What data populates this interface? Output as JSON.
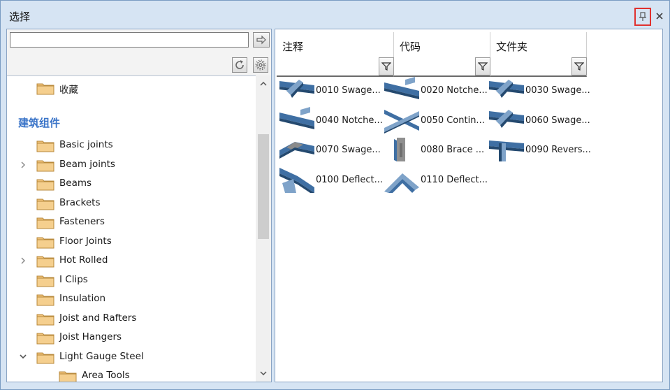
{
  "window": {
    "title": "选择"
  },
  "titlebar": {
    "pin_icon": "pin-icon",
    "close_icon": "close-icon"
  },
  "search": {
    "value": "",
    "placeholder": ""
  },
  "tree": {
    "favorites": "收藏",
    "group_header": "建筑组件",
    "items": [
      {
        "label": "Basic joints",
        "expander": ""
      },
      {
        "label": "Beam joints",
        "expander": ">"
      },
      {
        "label": "Beams",
        "expander": ""
      },
      {
        "label": "Brackets",
        "expander": ""
      },
      {
        "label": "Fasteners",
        "expander": ""
      },
      {
        "label": "Floor Joints",
        "expander": ""
      },
      {
        "label": "Hot Rolled",
        "expander": ">"
      },
      {
        "label": "I Clips",
        "expander": ""
      },
      {
        "label": "Insulation",
        "expander": ""
      },
      {
        "label": "Joist and Rafters",
        "expander": ""
      },
      {
        "label": "Joist Hangers",
        "expander": ""
      },
      {
        "label": "Light Gauge Steel",
        "expander": "v"
      },
      {
        "label": "Area Tools",
        "expander": ""
      }
    ]
  },
  "columns": [
    {
      "title": "注释"
    },
    {
      "title": "代码"
    },
    {
      "title": "文件夹"
    }
  ],
  "components": [
    {
      "label": "0010 Swage...",
      "thumb": "swage"
    },
    {
      "label": "0020 Notche...",
      "thumb": "notch"
    },
    {
      "label": "0030 Swage...",
      "thumb": "swage"
    },
    {
      "label": "0040 Notche...",
      "thumb": "notch"
    },
    {
      "label": "0050 Contin...",
      "thumb": "cross"
    },
    {
      "label": "0060 Swage...",
      "thumb": "swage"
    },
    {
      "label": "0070 Swage...",
      "thumb": "roof"
    },
    {
      "label": "0080 Brace ...",
      "thumb": "brace"
    },
    {
      "label": "0090 Revers...",
      "thumb": "reverse"
    },
    {
      "label": "0100 Deflect...",
      "thumb": "deflect"
    },
    {
      "label": "0110 Deflect...",
      "thumb": "deflect2"
    }
  ],
  "colors": {
    "accent": "#3a74c8",
    "steel": "#3f6fa3",
    "highlight": "#e0312e"
  }
}
